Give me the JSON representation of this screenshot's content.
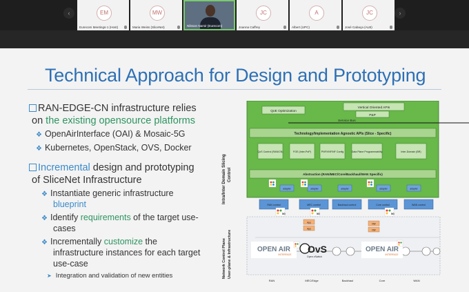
{
  "meeting": {
    "participants": [
      {
        "initials": "EM",
        "name": "Eurecom Meetings-1 (Host)"
      },
      {
        "initials": "MW",
        "name": "Maria Weiss (SliceNet)"
      },
      {
        "initials": "",
        "name": "Nilsson Namir (Eurecom)"
      },
      {
        "initials": "JC",
        "name": "Joanna Caffrey"
      },
      {
        "initials": "A",
        "name": "Albert (UPC)"
      },
      {
        "initials": "JC",
        "name": "José Cabaça (ALB)"
      }
    ],
    "prev_icon": "chevron-left-icon",
    "next_icon": "chevron-right-icon"
  },
  "slide": {
    "title": "Technical Approach for Design and Prototyping",
    "b1_pre": "RAN-EDGE-CN infrastructure relies",
    "b1_on": "on ",
    "b1_green": "the existing opensource platforms",
    "b1_sub1": "OpenAirInterface (OAI) & Mosaic-5G",
    "b1_sub2": "Kubernetes, OpenStack, OVS, Docker",
    "b2_blue": "Incremental",
    "b2_rest": " design and prototyping",
    "b2_line2": "of SliceNet Infrastructure",
    "s1_a": "Instantiate generic infrastructure",
    "s1_b": "blueprint",
    "s2_a": "Identify ",
    "s2_green": "requirements",
    "s2_b": " of the target  use-",
    "s2_c": "cases",
    "s3_a": "Incrementally ",
    "s3_green": "customize",
    "s3_b": " the",
    "s3_c": "infrastructure instances for each target",
    "s3_d": "use-case",
    "s4": "Integration and validation of new entities"
  },
  "diagram": {
    "left_label_top_1": "Intra/Inter Domain Slicing",
    "left_label_top_2": "Control",
    "left_label_bottom_1": "Network Control Plane",
    "left_label_bottom_2": "User-plane & Infrastructure",
    "qoe": "QoE Optimization",
    "vertical_apis": "Vertical Oriented APIs",
    "pnp": "P&P",
    "service_bus": "Service Bus",
    "tech_apis": "Technology/Implementation Agnostic APIs (Slice - Specific)",
    "modules": [
      "QoS Control (RAN/CN)",
      "FGE (Inter-PoP)",
      "PNF/VNF/NF Config",
      "Data Plane Programmability",
      "Inter-Domain (BR)"
    ],
    "abstraction": "Abstraction (RAN/MEC/Core/Backhaul/WAN  Specific)",
    "adapter": "adapter",
    "controllers": [
      "RAN control",
      "MEC control",
      "Backhaul control",
      "Core control",
      "WAN control"
    ],
    "columns": [
      "RAN",
      "MEC/Edge",
      "Backhaul",
      "Core",
      "WAN"
    ],
    "openair_1": "OPEN AIR",
    "openair_2": "INTERFACE",
    "ovs_1": "OvS",
    "ovs_2": "Open vSwitch",
    "badge_5g": "5G",
    "app": "App",
    "vnf": "VNF"
  }
}
